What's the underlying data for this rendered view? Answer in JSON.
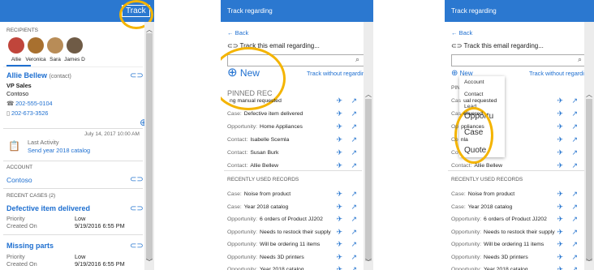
{
  "p1": {
    "track_label": "Track",
    "recipients_header": "RECIPIENTS",
    "recipients": [
      {
        "name": "Allie",
        "color": "#c0453b"
      },
      {
        "name": "Veronica",
        "color": "#a8702f"
      },
      {
        "name": "Sara",
        "color": "#b88c57"
      },
      {
        "name": "James D",
        "color": "#6f5b46"
      }
    ],
    "contact": {
      "name": "Allie Bellew",
      "type": "(contact)",
      "title": "VP Sales",
      "company": "Contoso",
      "phone1": "202-555-0104",
      "phone2": "202-673-3526",
      "last_activity_date": "July 14, 2017 10:00 AM",
      "last_activity_label": "Last Activity",
      "last_activity_text": "Send year 2018 catalog"
    },
    "account_header": "ACCOUNT",
    "account_name": "Contoso",
    "recent_cases_header": "RECENT CASES (2)",
    "cases": [
      {
        "title": "Defective item delivered",
        "priority_label": "Priority",
        "priority": "Low",
        "created_label": "Created On",
        "created": "9/19/2016 6:55 PM"
      },
      {
        "title": "Missing parts",
        "priority_label": "Priority",
        "priority": "Low",
        "created_label": "Created On",
        "created": "9/19/2016 6:55 PM"
      }
    ]
  },
  "p2": {
    "title": "Track regarding",
    "back": "Back",
    "track_email": "Track this email regarding...",
    "new_label": "New",
    "track_without": "Track without regarding",
    "pinned_header": "PINNED REC",
    "pinned": [
      {
        "type": "",
        "name": "ng manual requested"
      },
      {
        "type": "Case:",
        "name": "Defective item delivered"
      },
      {
        "type": "Opportunity:",
        "name": "Home Appliances"
      },
      {
        "type": "Contact:",
        "name": "Isabelle Scemla"
      },
      {
        "type": "Contact:",
        "name": "Susan Burk"
      },
      {
        "type": "Contact:",
        "name": "Allie Bellew"
      }
    ],
    "recent_header": "RECENTLY USED RECORDS",
    "recent": [
      {
        "type": "Case:",
        "name": "Noise from product"
      },
      {
        "type": "Case:",
        "name": "Year 2018 catalog"
      },
      {
        "type": "Opportunity:",
        "name": "6 orders of Product JJ202"
      },
      {
        "type": "Opportunity:",
        "name": "Needs to restock their supply"
      },
      {
        "type": "Opportunity:",
        "name": "Will be ordering 11 items"
      },
      {
        "type": "Opportunity:",
        "name": "Needs 3D printers"
      },
      {
        "type": "Opportunity:",
        "name": "Year 2018 catalog"
      }
    ]
  },
  "p3": {
    "title": "Track regarding",
    "back": "Back",
    "track_email": "Track this email regarding...",
    "new_label": "New",
    "track_without": "Track without regarding",
    "pinned_header": "PIN",
    "pinned": [
      {
        "type": "Cas",
        "name": "ual requested"
      },
      {
        "type": "Cas",
        "name": "elivered"
      },
      {
        "type": "Op",
        "name": "ppliances"
      },
      {
        "type": "Co",
        "name": "nla"
      },
      {
        "type": "Co",
        "name": ""
      },
      {
        "type": "Contact:",
        "name": "Allie Bellew"
      }
    ],
    "dropdown": [
      "Account",
      "Contact",
      "Lead",
      "Opportu",
      "Case",
      "Quote"
    ],
    "recent_header": "RECENTLY USED RECORDS",
    "recent": [
      {
        "type": "Case:",
        "name": "Noise from product"
      },
      {
        "type": "Case:",
        "name": "Year 2018 catalog"
      },
      {
        "type": "Opportunity:",
        "name": "6 orders of Product JJ202"
      },
      {
        "type": "Opportunity:",
        "name": "Needs to restock their supply"
      },
      {
        "type": "Opportunity:",
        "name": "Will be ordering 11 items"
      },
      {
        "type": "Opportunity:",
        "name": "Needs 3D printers"
      },
      {
        "type": "Opportunity:",
        "name": "Year 2018 catalog"
      }
    ]
  }
}
